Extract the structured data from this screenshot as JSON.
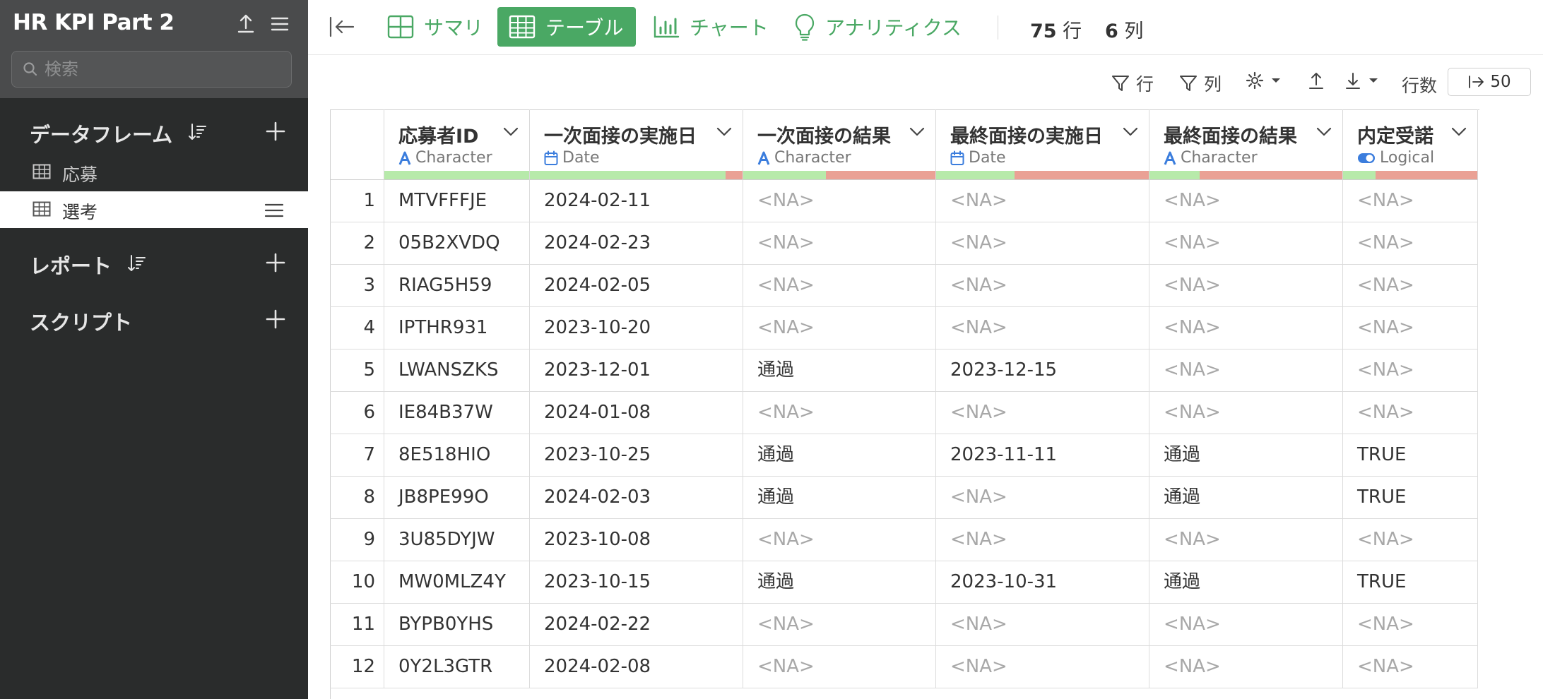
{
  "app": {
    "title": "HR KPI Part 2",
    "search_placeholder": "検索"
  },
  "sidebar": {
    "dataframes_title": "データフレーム",
    "dataframes": [
      {
        "label": "応募",
        "selected": false
      },
      {
        "label": "選考",
        "selected": true
      }
    ],
    "reports_title": "レポート",
    "scripts_title": "スクリプト"
  },
  "toolbar": {
    "tabs": [
      {
        "label": "サマリ",
        "icon": "summary-grid-icon"
      },
      {
        "label": "テーブル",
        "icon": "table-icon",
        "active": true
      },
      {
        "label": "チャート",
        "icon": "bar-chart-icon"
      },
      {
        "label": "アナリティクス",
        "icon": "lightbulb-icon"
      }
    ],
    "rows_count": "75",
    "rows_unit": "行",
    "cols_count": "6",
    "cols_unit": "列"
  },
  "subbar": {
    "filter_rows": "行",
    "filter_cols": "列",
    "rows_label": "行数",
    "rows_value": "50"
  },
  "accent_color": "#4aa864",
  "table": {
    "columns": [
      {
        "name": "応募者ID",
        "type": "Character",
        "valid_fraction": 1.0
      },
      {
        "name": "一次面接の実施日",
        "type": "Date",
        "valid_fraction": 0.92
      },
      {
        "name": "一次面接の結果",
        "type": "Character",
        "valid_fraction": 0.43
      },
      {
        "name": "最終面接の実施日",
        "type": "Date",
        "valid_fraction": 0.37
      },
      {
        "name": "最終面接の結果",
        "type": "Character",
        "valid_fraction": 0.26
      },
      {
        "name": "内定受諾",
        "type": "Logical",
        "valid_fraction": 0.24
      }
    ],
    "rows": [
      [
        "1",
        "MTVFFFJE",
        "2024-02-11",
        "<NA>",
        "<NA>",
        "<NA>",
        "<NA>"
      ],
      [
        "2",
        "05B2XVDQ",
        "2024-02-23",
        "<NA>",
        "<NA>",
        "<NA>",
        "<NA>"
      ],
      [
        "3",
        "RIAG5H59",
        "2024-02-05",
        "<NA>",
        "<NA>",
        "<NA>",
        "<NA>"
      ],
      [
        "4",
        "IPTHR931",
        "2023-10-20",
        "<NA>",
        "<NA>",
        "<NA>",
        "<NA>"
      ],
      [
        "5",
        "LWANSZKS",
        "2023-12-01",
        "通過",
        "2023-12-15",
        "<NA>",
        "<NA>"
      ],
      [
        "6",
        "IE84B37W",
        "2024-01-08",
        "<NA>",
        "<NA>",
        "<NA>",
        "<NA>"
      ],
      [
        "7",
        "8E518HIO",
        "2023-10-25",
        "通過",
        "2023-11-11",
        "通過",
        "TRUE"
      ],
      [
        "8",
        "JB8PE99O",
        "2024-02-03",
        "通過",
        "<NA>",
        "通過",
        "TRUE"
      ],
      [
        "9",
        "3U85DYJW",
        "2023-10-08",
        "<NA>",
        "<NA>",
        "<NA>",
        "<NA>"
      ],
      [
        "10",
        "MW0MLZ4Y",
        "2023-10-15",
        "通過",
        "2023-10-31",
        "通過",
        "TRUE"
      ],
      [
        "11",
        "BYPB0YHS",
        "2024-02-22",
        "<NA>",
        "<NA>",
        "<NA>",
        "<NA>"
      ],
      [
        "12",
        "0Y2L3GTR",
        "2024-02-08",
        "<NA>",
        "<NA>",
        "<NA>",
        "<NA>"
      ]
    ]
  }
}
